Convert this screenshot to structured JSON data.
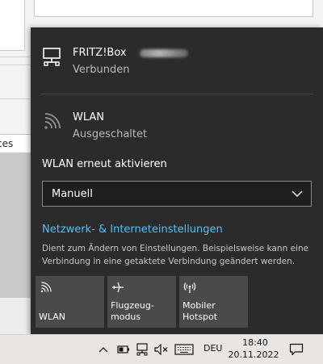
{
  "background": {
    "tab_partial_label": "ces"
  },
  "flyout": {
    "connections": [
      {
        "name": "FRITZ!Box",
        "status": "Verbunden",
        "icon": "ethernet-icon"
      },
      {
        "name": "WLAN",
        "status": "Ausgeschaltet",
        "icon": "wifi-off-icon"
      }
    ],
    "reenable_label": "WLAN erneut aktivieren",
    "reenable_select": {
      "value": "Manuell"
    },
    "settings_link": "Netzwerk- & Interneteinstellungen",
    "settings_description": "Dient zum Ändern von Einstellungen. Beispielsweise kann eine Verbindung in eine getaktete Verbindung geändert werden.",
    "tiles": [
      {
        "label": "WLAN",
        "icon": "wifi-icon"
      },
      {
        "label": "Flugzeug-\nmodus",
        "icon": "airplane-icon"
      },
      {
        "label": "Mobiler\nHotspot",
        "icon": "hotspot-icon"
      }
    ]
  },
  "taskbar": {
    "language": "DEU",
    "time": "18:40",
    "date": "20.11.2022"
  },
  "colors": {
    "flyout_bg": "#2b2b2b",
    "tile_bg": "#4a4a4a",
    "link": "#4cc2ff",
    "taskbar_bg": "#e9e5e2"
  }
}
